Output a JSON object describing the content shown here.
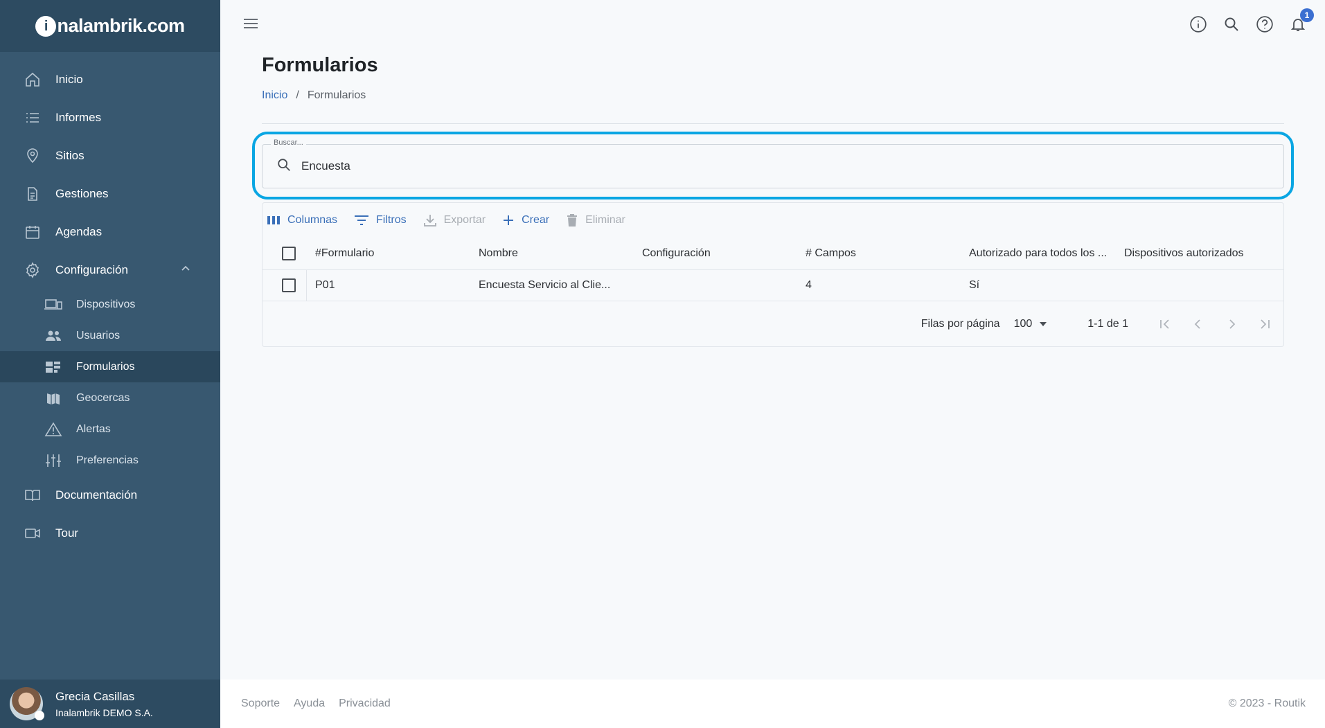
{
  "brand": {
    "prefix": "i",
    "name": "nalambrik.com"
  },
  "sidebar": {
    "items": [
      {
        "label": "Inicio",
        "icon": "home-icon"
      },
      {
        "label": "Informes",
        "icon": "list-icon"
      },
      {
        "label": "Sitios",
        "icon": "location-pin-icon"
      },
      {
        "label": "Gestiones",
        "icon": "document-icon"
      },
      {
        "label": "Agendas",
        "icon": "calendar-icon"
      },
      {
        "label": "Configuración",
        "icon": "gear-icon"
      }
    ],
    "sub_items": [
      {
        "label": "Dispositivos",
        "icon": "devices-icon"
      },
      {
        "label": "Usuarios",
        "icon": "users-icon"
      },
      {
        "label": "Formularios",
        "icon": "forms-icon"
      },
      {
        "label": "Geocercas",
        "icon": "map-icon"
      },
      {
        "label": "Alertas",
        "icon": "warning-icon"
      },
      {
        "label": "Preferencias",
        "icon": "sliders-icon"
      }
    ],
    "lower_items": [
      {
        "label": "Documentación",
        "icon": "book-icon"
      },
      {
        "label": "Tour",
        "icon": "video-icon"
      }
    ],
    "active": "Formularios"
  },
  "user": {
    "name": "Grecia Casillas",
    "org": "Inalambrik DEMO S.A."
  },
  "topbar": {
    "notifications_count": "1"
  },
  "page": {
    "title": "Formularios"
  },
  "breadcrumb": {
    "home": "Inicio",
    "current": "Formularios"
  },
  "search": {
    "legend": "Buscar...",
    "value": "Encuesta"
  },
  "toolbar": {
    "columns": "Columnas",
    "filters": "Filtros",
    "export": "Exportar",
    "create": "Crear",
    "delete": "Eliminar"
  },
  "table": {
    "headers": [
      "#Formulario",
      "Nombre",
      "Configuración",
      "# Campos",
      "Autorizado para todos los ...",
      "Dispositivos autorizados"
    ],
    "rows": [
      [
        "P01",
        "Encuesta Servicio al Clie...",
        "",
        "4",
        "Sí",
        ""
      ]
    ]
  },
  "pagination": {
    "rows_label": "Filas por página",
    "rows_value": "100",
    "range": "1-1 de 1"
  },
  "footer": {
    "support": "Soporte",
    "help": "Ayuda",
    "privacy": "Privacidad",
    "copyright": "© 2023 - Routik"
  },
  "colors": {
    "sidebar": "#385870",
    "sidebar_dark": "#2d4b61",
    "accent": "#3a6fb8",
    "highlight": "#0aa6e3"
  }
}
